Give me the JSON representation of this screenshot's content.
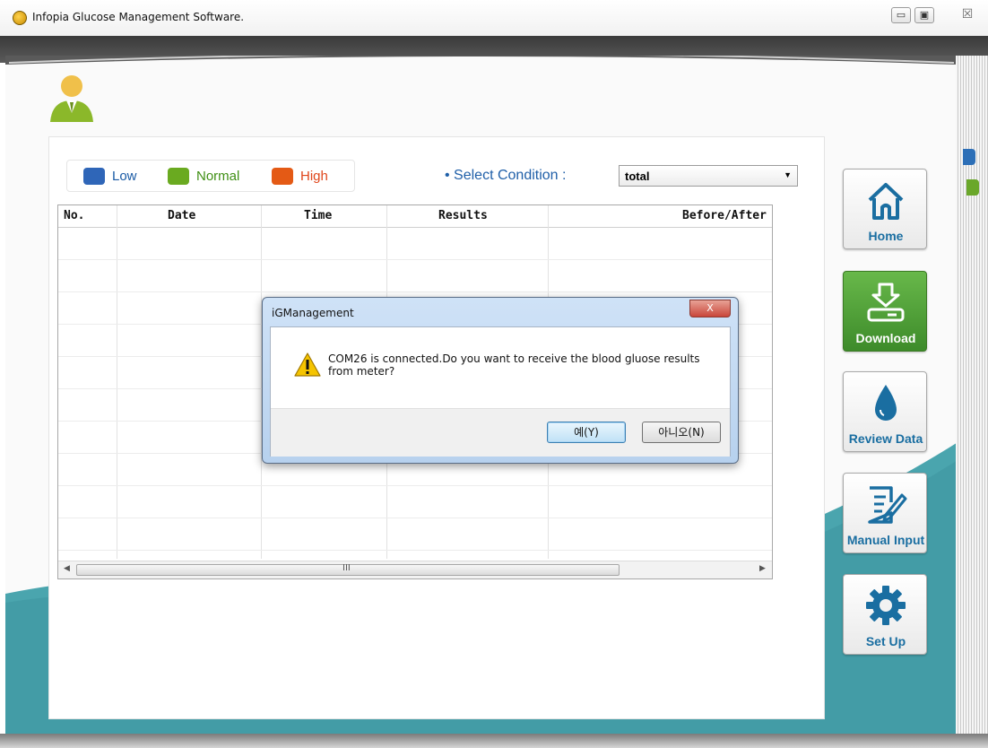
{
  "window": {
    "title": "Infopia Glucose Management Software.",
    "minimize": "▭",
    "restore": "▣",
    "close": "☒"
  },
  "legend": [
    {
      "label": "Low",
      "color": "#2f66b8",
      "text_color": "#1a5aa5"
    },
    {
      "label": "Normal",
      "color": "#6aaa20",
      "text_color": "#3f8f14"
    },
    {
      "label": "High",
      "color": "#e45a15",
      "text_color": "#e0461b"
    }
  ],
  "condition": {
    "label": "• Select Condition :",
    "selected": "total",
    "arrow": "▼"
  },
  "table": {
    "columns": [
      "No.",
      "Date",
      "Time",
      "Results",
      "Before/After"
    ],
    "scroll_left": "◀",
    "scroll_right": "▶",
    "scroll_grip": "III"
  },
  "sidebar": {
    "items": [
      {
        "label": "Home",
        "icon": "home-icon",
        "active": false
      },
      {
        "label": "Download",
        "icon": "download-icon",
        "active": true
      },
      {
        "label": "Review Data",
        "icon": "water-drop-icon",
        "active": false
      },
      {
        "label": "Manual Input",
        "icon": "edit-document-icon",
        "active": false
      },
      {
        "label": "Set Up",
        "icon": "gear-icon",
        "active": false
      }
    ]
  },
  "dialog": {
    "title": "iGManagement",
    "close": "X",
    "message": "COM26 is connected.Do you want to receive the blood gluose results from meter?",
    "yes_label": "예(Y)",
    "no_label": "아니오(N)"
  },
  "colors": {
    "accent_blue": "#1a6ea1",
    "teal": "#4aa5ae",
    "download_green": "#4f9e32"
  }
}
